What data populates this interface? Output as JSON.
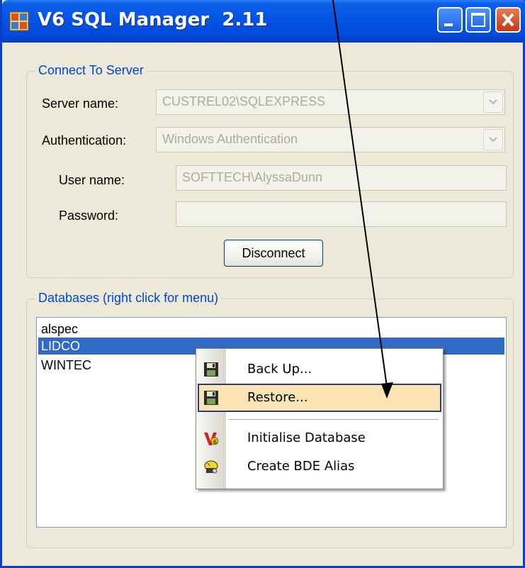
{
  "window": {
    "title": "V6 SQL Manager  2.11"
  },
  "connect_group": {
    "legend": "Connect To Server",
    "server_label": "Server name:",
    "server_value": "CUSTREL02\\SQLEXPRESS",
    "auth_label": "Authentication:",
    "auth_value": "Windows Authentication",
    "user_label": "User name:",
    "user_value": "SOFTTECH\\AlyssaDunn",
    "password_label": "Password:",
    "password_value": "",
    "disconnect_label": "Disconnect"
  },
  "databases_group": {
    "legend": "Databases (right click for menu)",
    "items": [
      {
        "label": "alspec",
        "selected": false
      },
      {
        "label": "LIDCO",
        "selected": true
      },
      {
        "label": "WINTEC",
        "selected": false
      }
    ]
  },
  "context_menu": {
    "items": [
      {
        "label": "Back Up...",
        "icon": "floppy-disk-icon"
      },
      {
        "label": "Restore...",
        "icon": "floppy-disk-icon",
        "highlighted": true
      },
      {
        "label": "Initialise Database",
        "icon": "v6-logo-icon"
      },
      {
        "label": "Create BDE Alias",
        "icon": "bde-alias-icon"
      }
    ]
  },
  "colors": {
    "titlebar": "#0556e6",
    "selection": "#316ac5",
    "menu_highlight": "#fbe4b4",
    "legend_text": "#0046d5"
  }
}
